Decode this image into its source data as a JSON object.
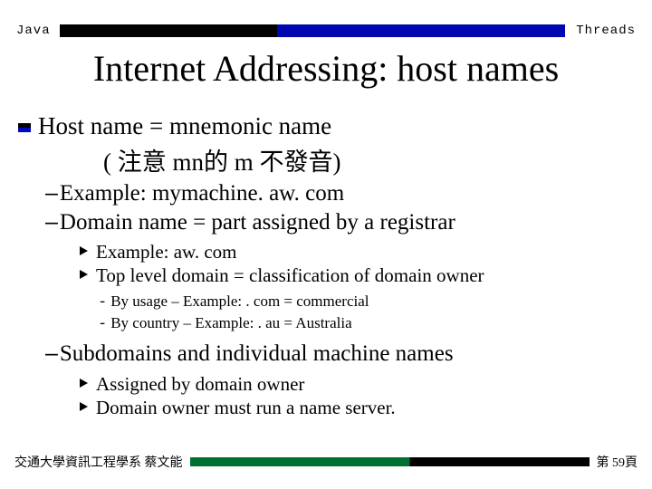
{
  "header": {
    "left": "Java",
    "right": "Threads"
  },
  "title": "Internet Addressing: host names",
  "bullets": {
    "l1a": "Host name = mnemonic name",
    "l1b": "( 注意 mn的 m 不發音)",
    "l2a": "Example: mymachine. aw. com",
    "l2b": "Domain name = part assigned by a registrar",
    "l3a": "Example: aw. com",
    "l3b": "Top level domain = classification of domain owner",
    "l4a": "By usage – Example:   . com = commercial",
    "l4b": "By country – Example:   . au = Australia",
    "l2c": "Subdomains and individual machine names",
    "l3c": "Assigned by domain owner",
    "l3d": "Domain owner must run a name server."
  },
  "footer": {
    "left": "交通大學資訊工程學系 蔡文能",
    "right": "第 59頁"
  }
}
